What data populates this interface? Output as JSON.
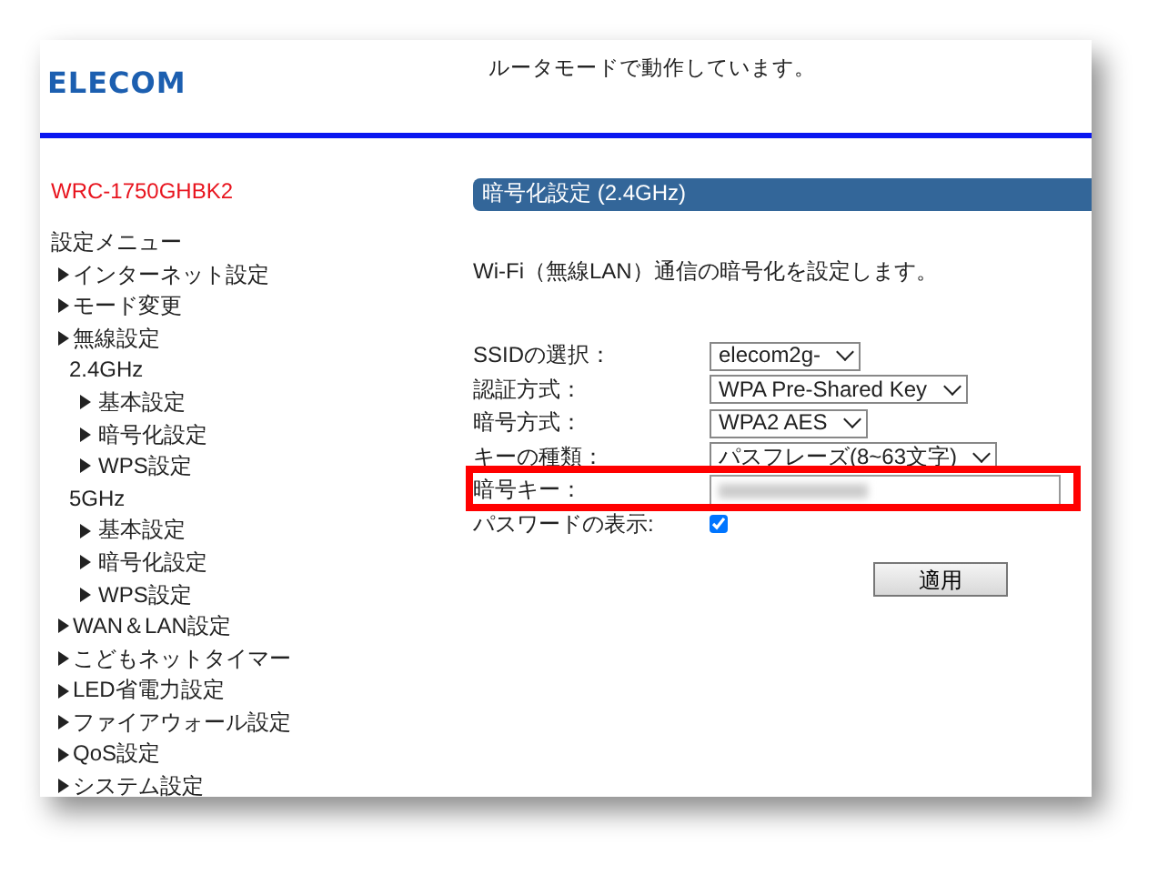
{
  "header": {
    "logo": "ELECOM",
    "status": "ルータモードで動作しています。"
  },
  "sidebar": {
    "model": "WRC-1750GHBK2",
    "menu_title": "設定メニュー",
    "items": [
      {
        "kind": "link",
        "label": "インターネット設定"
      },
      {
        "kind": "link",
        "label": "モード変更"
      },
      {
        "kind": "link",
        "label": "無線設定",
        "children": [
          {
            "kind": "group",
            "label": "2.4GHz",
            "children": [
              {
                "kind": "link",
                "label": "基本設定"
              },
              {
                "kind": "link",
                "label": "暗号化設定"
              },
              {
                "kind": "link",
                "label": "WPS設定"
              }
            ]
          },
          {
            "kind": "group",
            "label": "5GHz",
            "children": [
              {
                "kind": "link",
                "label": "基本設定"
              },
              {
                "kind": "link",
                "label": "暗号化設定"
              },
              {
                "kind": "link",
                "label": "WPS設定"
              }
            ]
          }
        ]
      },
      {
        "kind": "link",
        "label": "WAN＆LAN設定"
      },
      {
        "kind": "link",
        "label": "こどもネットタイマー"
      },
      {
        "kind": "link",
        "label": "LED省電力設定"
      },
      {
        "kind": "link",
        "label": "ファイアウォール設定"
      },
      {
        "kind": "link",
        "label": "QoS設定"
      },
      {
        "kind": "link",
        "label": "システム設定"
      }
    ]
  },
  "main": {
    "title": "暗号化設定 (2.4GHz)",
    "description": "Wi-Fi（無線LAN）通信の暗号化を設定します。",
    "fields": [
      {
        "kind": "select",
        "label": "SSIDの選択：",
        "value": "elecom2g-"
      },
      {
        "kind": "select",
        "label": "認証方式：",
        "value": "WPA Pre-Shared Key"
      },
      {
        "kind": "select",
        "label": "暗号方式：",
        "value": "WPA2 AES"
      },
      {
        "kind": "select",
        "label": "キーの種類：",
        "value": "パスフレーズ(8~63文字)"
      },
      {
        "kind": "secret",
        "label": "暗号キー：",
        "highlighted": true
      },
      {
        "kind": "checkbox",
        "label": "パスワードの表示:",
        "checked": true
      }
    ],
    "apply_button": "適用"
  }
}
